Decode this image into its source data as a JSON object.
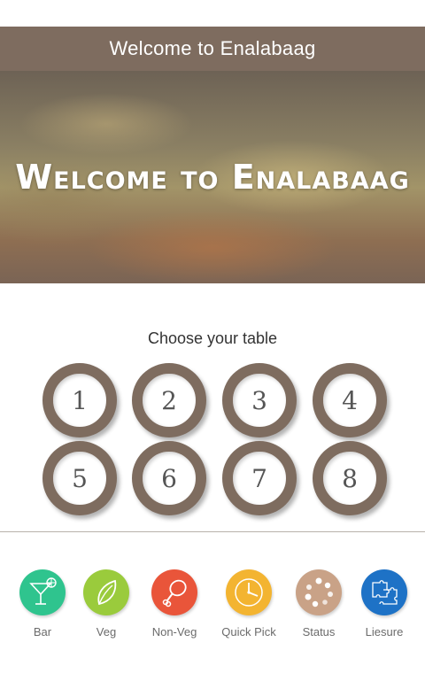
{
  "header": {
    "title": "Welcome to Enalabaag"
  },
  "hero": {
    "title": "Welcome to Enalabaag"
  },
  "tables": {
    "prompt": "Choose your table",
    "items": [
      "1",
      "2",
      "3",
      "4",
      "5",
      "6",
      "7",
      "8"
    ]
  },
  "nav": {
    "items": [
      {
        "label": "Bar",
        "icon": "cocktail-icon",
        "color": "#2fc48e"
      },
      {
        "label": "Veg",
        "icon": "leaf-icon",
        "color": "#9acb3c"
      },
      {
        "label": "Non-Veg",
        "icon": "drumstick-icon",
        "color": "#e9553a"
      },
      {
        "label": "Quick Pick",
        "icon": "clock-icon",
        "color": "#f3b431"
      },
      {
        "label": "Status",
        "icon": "status-dots-icon",
        "color": "#c9a287"
      },
      {
        "label": "Liesure",
        "icon": "puzzle-icon",
        "color": "#1e72c6"
      }
    ]
  },
  "colors": {
    "brand": "#7e6c5f"
  }
}
